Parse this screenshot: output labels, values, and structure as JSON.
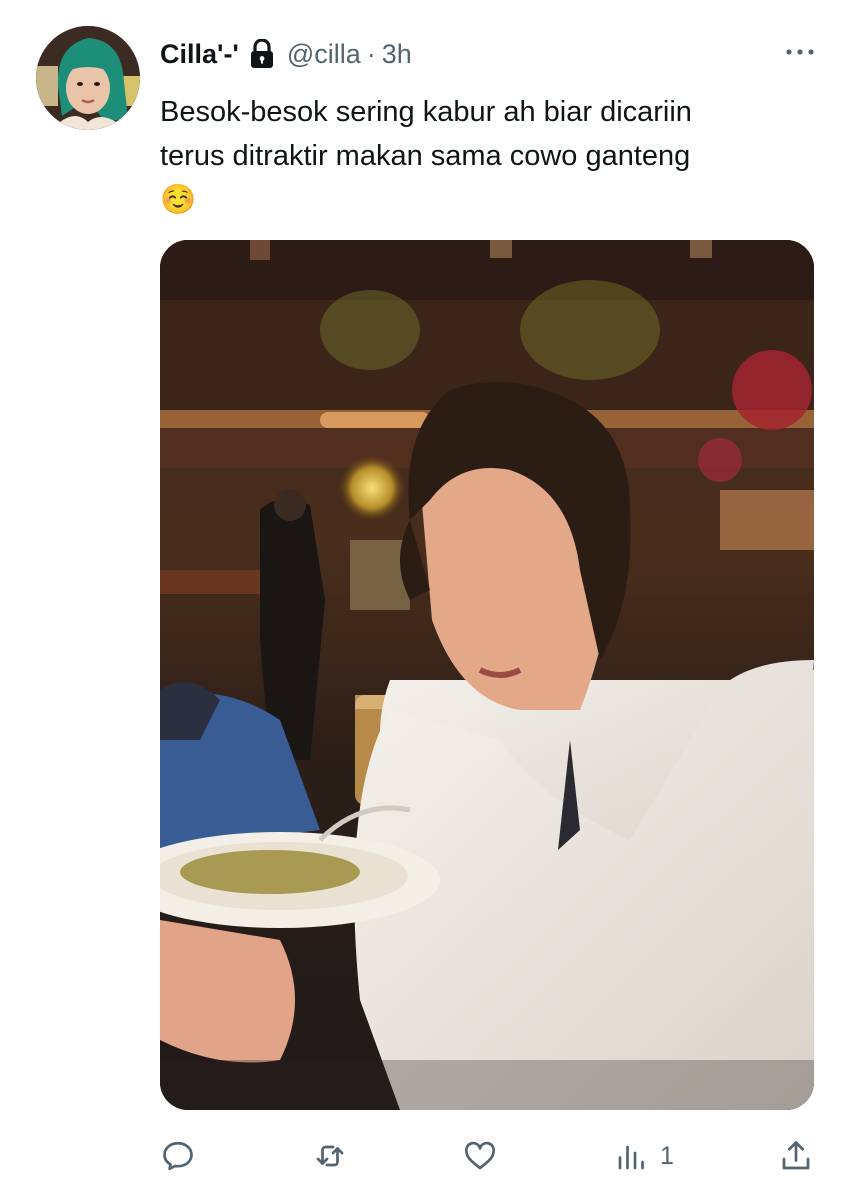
{
  "tweet": {
    "display_name": "Cilla'-'",
    "handle": "@cilla",
    "separator": "·",
    "time": "3h",
    "text_line1": "Besok-besok sering kabur ah biar dicariin",
    "text_line2": "terus ditraktir makan sama cowo ganteng",
    "emoji": "☺️"
  },
  "icons": {
    "lock": "lock-icon",
    "more": "more-horizontal-icon",
    "reply": "reply-icon",
    "retweet": "retweet-icon",
    "like": "heart-icon",
    "views": "views-icon",
    "share": "share-icon"
  },
  "actions": {
    "views_count": "1"
  },
  "colors": {
    "text_primary": "#0f1419",
    "text_secondary": "#536471"
  }
}
